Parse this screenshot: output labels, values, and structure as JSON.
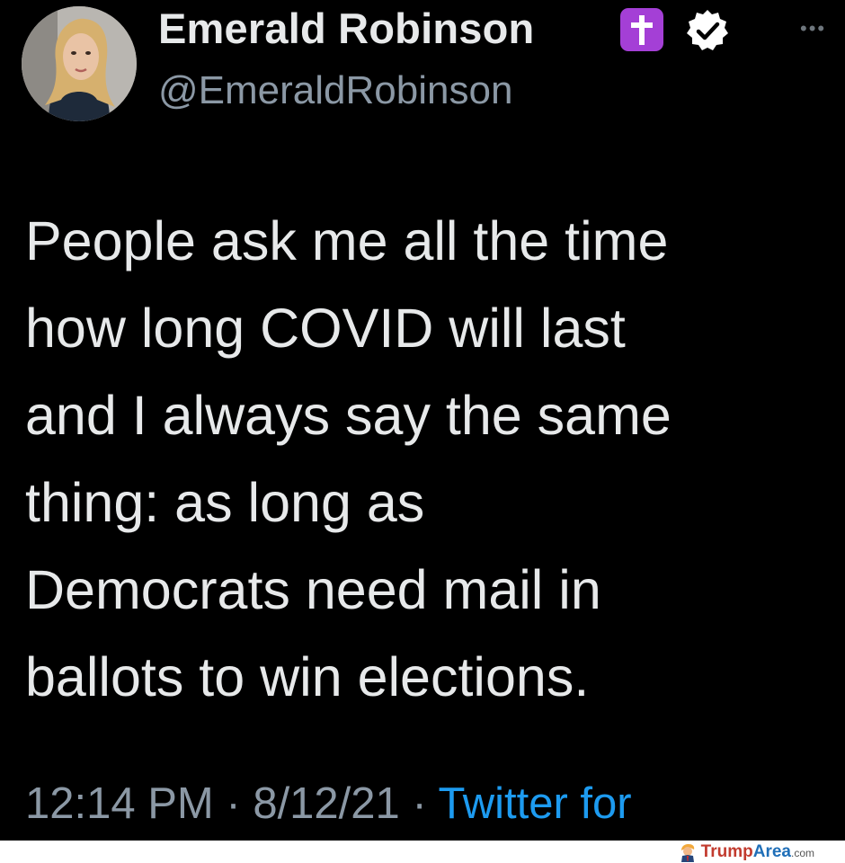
{
  "tweet": {
    "author": {
      "display_name": "Emerald Robinson",
      "handle": "@EmeraldRobinson",
      "badges": [
        "latin-cross-emoji-icon",
        "verified-check-icon"
      ],
      "avatar": "avatar-photo"
    },
    "more_icon": "more-dots-icon",
    "text_lines": [
      "People ask me all the time",
      "how long COVID will last",
      "and I always say the same",
      "thing: as long as",
      "Democrats need mail in",
      "ballots to win elections."
    ],
    "meta": {
      "time": "12:14 PM",
      "separator": "·",
      "date": "8/12/21",
      "source": "Twitter for"
    }
  },
  "watermark": {
    "brand_part1": "Trump",
    "brand_part2": "Area",
    "brand_tld": ".com",
    "icon": "trump-figure-icon"
  },
  "colors": {
    "background": "#000000",
    "primary_text": "#e7e9ea",
    "secondary_text": "#8b98a5",
    "link": "#1d9bf0",
    "cross_badge": "#a43fd6"
  }
}
